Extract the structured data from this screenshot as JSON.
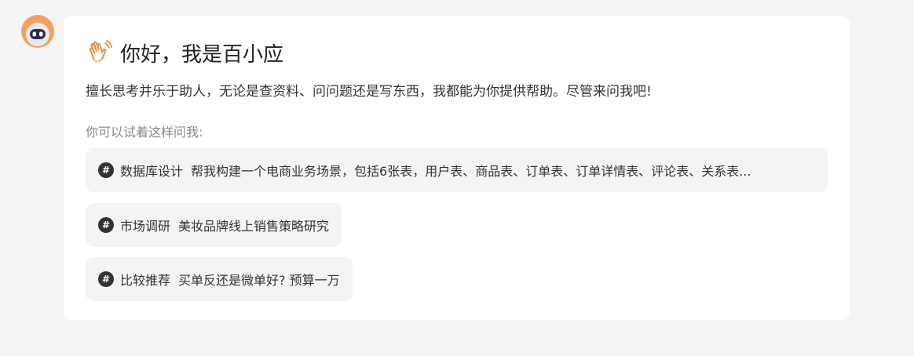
{
  "assistant": {
    "avatar_icon": "robot-avatar-icon",
    "avatar_color": "#f4a15d"
  },
  "greeting": {
    "icon": "waving-hand-icon",
    "title": "你好，我是百小应",
    "intro": "擅长思考并乐于助人，无论是查资料、问问题还是写东西，我都能为你提供帮助。尽管来问我吧!"
  },
  "hint": "你可以试着这样问我:",
  "suggestions": [
    {
      "icon": "hash-icon",
      "tag": "数据库设计",
      "prompt": "帮我构建一个电商业务场景，包括6张表，用户表、商品表、订单表、订单详情表、评论表、关系表..."
    },
    {
      "icon": "hash-icon",
      "tag": "市场调研",
      "prompt": "美妆品牌线上销售策略研究"
    },
    {
      "icon": "hash-icon",
      "tag": "比较推荐",
      "prompt": "买单反还是微单好? 预算一万"
    }
  ]
}
